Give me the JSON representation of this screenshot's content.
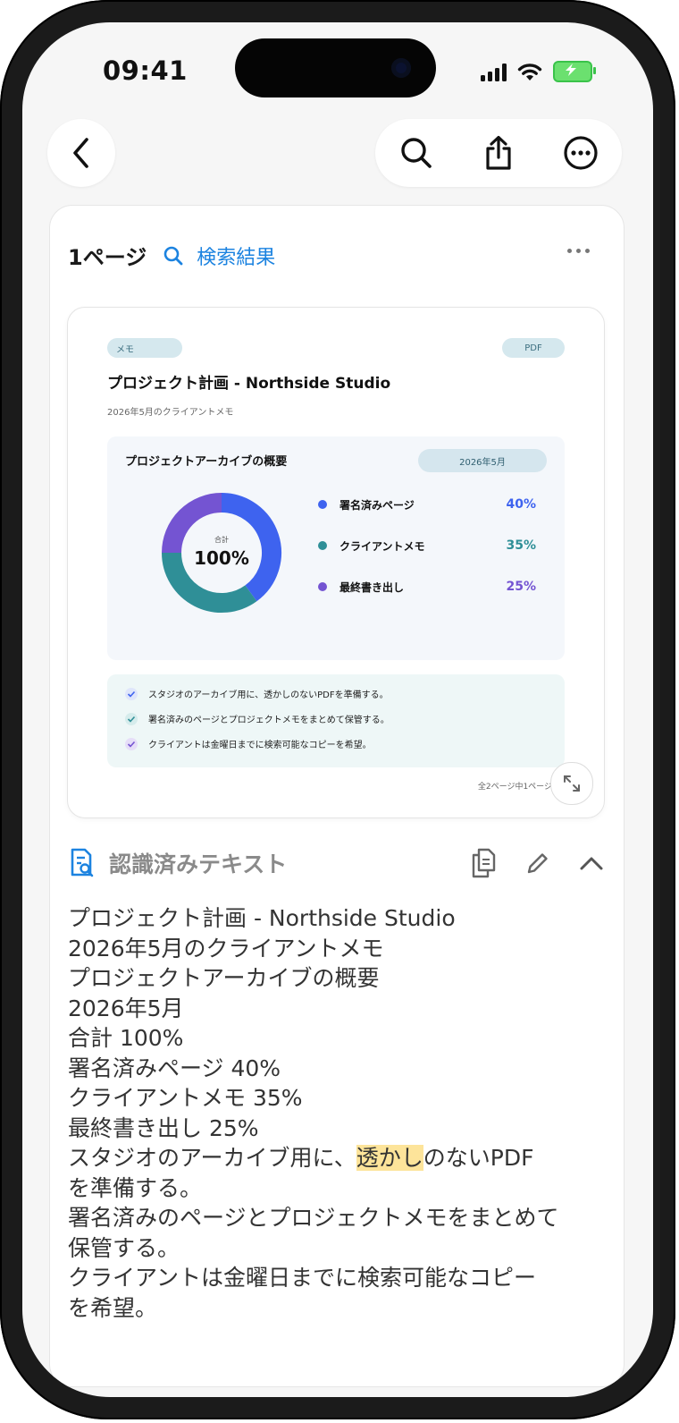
{
  "status_bar": {
    "time": "09:41"
  },
  "colors": {
    "accent": "#1c83e0",
    "signed": "#3e63ef",
    "client": "#2f8f97",
    "export": "#7454d2",
    "highlight": "#fde49a"
  },
  "nav": {
    "back_icon": "chevron-left-icon",
    "search_icon": "search-icon",
    "share_icon": "share-icon",
    "more_icon": "more-circle-icon"
  },
  "card": {
    "page_label": "1ページ",
    "search_label": "検索結果"
  },
  "preview": {
    "tag_memo": "メモ",
    "tag_pdf": "PDF",
    "title": "プロジェクト計画 - Northside Studio",
    "subtitle": "2026年5月のクライアントメモ",
    "summary_title": "プロジェクトアーカイブの概要",
    "summary_badge": "2026年5月",
    "donut_center_label": "合計",
    "donut_center_value": "100%",
    "checklist": [
      "スタジオのアーカイブ用に、透かしのないPDFを準備する。",
      "署名済みのページとプロジェクトメモをまとめて保管する。",
      "クライアントは金曜日までに検索可能なコピーを希望。"
    ],
    "pager": "全2ページ中1ページ"
  },
  "chart_data": {
    "type": "pie",
    "categories": [
      "署名済みページ",
      "クライアントメモ",
      "最終書き出し"
    ],
    "values": [
      40,
      35,
      25
    ],
    "value_labels": [
      "40%",
      "35%",
      "25%"
    ],
    "colors": [
      "#3e63ef",
      "#2f8f97",
      "#7454d2"
    ],
    "title": "プロジェクトアーカイブの概要"
  },
  "recognized": {
    "title": "認識済みテキスト",
    "lines": [
      "プロジェクト計画 - Northside Studio",
      "2026年5月のクライアントメモ",
      "プロジェクトアーカイブの概要",
      "2026年5月",
      "合計 100%",
      "署名済みページ 40%",
      "クライアントメモ 35%",
      "最終書き出し 25%"
    ],
    "line9_before": "スタジオのアーカイブ用に、",
    "line9_highlight": "透かし",
    "line9_after": "のないPDF",
    "rest_lines": [
      "を準備する。",
      "署名済みのページとプロジェクトメモをまとめて",
      "保管する。",
      "クライアントは金曜日までに検索可能なコピー",
      "を希望。"
    ]
  }
}
